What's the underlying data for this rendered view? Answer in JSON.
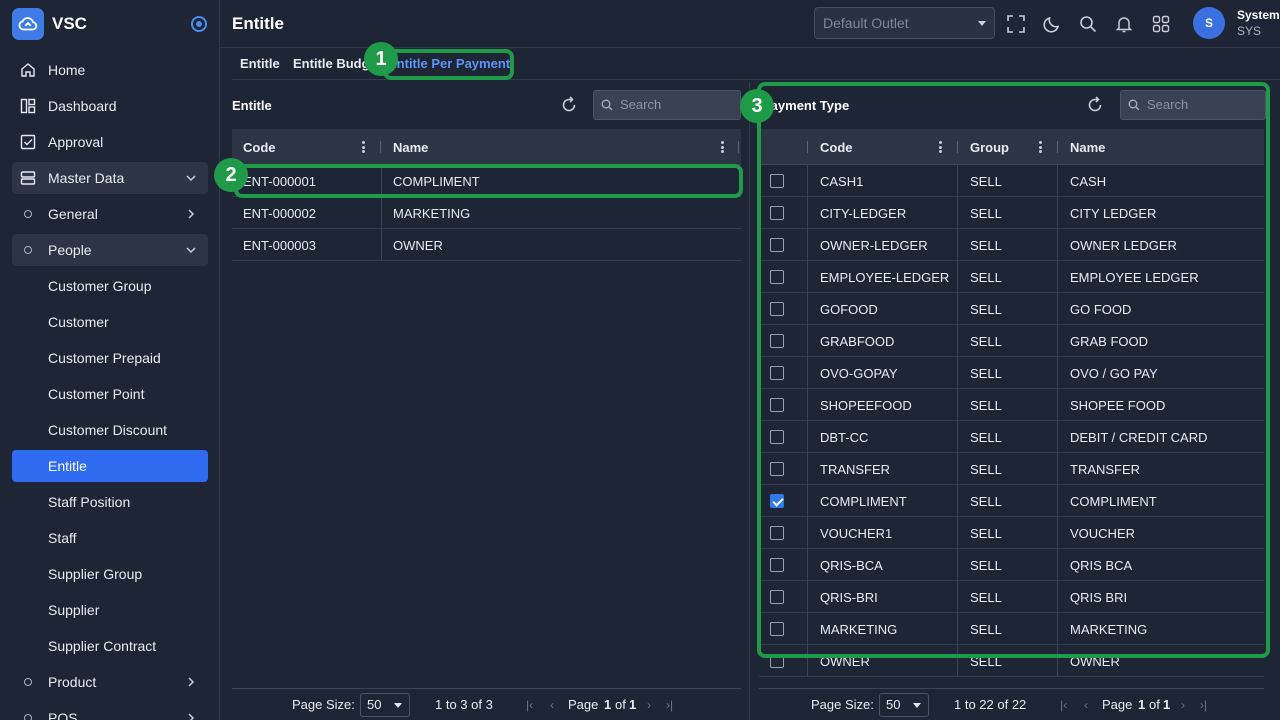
{
  "app": {
    "name": "VSC"
  },
  "topbar": {
    "title": "Entitle",
    "outlet_placeholder": "Default Outlet",
    "user": {
      "initial": "S",
      "name": "System",
      "code": "SYS"
    }
  },
  "sidebar": {
    "items": [
      {
        "label": "Home",
        "icon": "home-icon"
      },
      {
        "label": "Dashboard",
        "icon": "dashboard-icon"
      },
      {
        "label": "Approval",
        "icon": "approval-icon"
      },
      {
        "label": "Master Data",
        "icon": "database-icon"
      },
      {
        "label": "General"
      },
      {
        "label": "People"
      },
      {
        "label": "Customer Group"
      },
      {
        "label": "Customer"
      },
      {
        "label": "Customer Prepaid"
      },
      {
        "label": "Customer Point"
      },
      {
        "label": "Customer Discount"
      },
      {
        "label": "Entitle"
      },
      {
        "label": "Staff Position"
      },
      {
        "label": "Staff"
      },
      {
        "label": "Supplier Group"
      },
      {
        "label": "Supplier"
      },
      {
        "label": "Supplier Contract"
      },
      {
        "label": "Product"
      },
      {
        "label": "POS"
      }
    ]
  },
  "tabs": [
    "Entitle",
    "Entitle Budget",
    "Entitle Per Payment"
  ],
  "left_panel": {
    "title": "Entitle",
    "search_placeholder": "Search",
    "columns": [
      "Code",
      "Name"
    ],
    "rows": [
      {
        "code": "ENT-000001",
        "name": "COMPLIMENT"
      },
      {
        "code": "ENT-000002",
        "name": "MARKETING"
      },
      {
        "code": "ENT-000003",
        "name": "OWNER"
      }
    ],
    "pager": {
      "page_size_label": "Page Size:",
      "page_size": "50",
      "range": "1 to 3 of 3",
      "page_word": "Page",
      "page": "1",
      "of_word": "of",
      "total": "1"
    }
  },
  "right_panel": {
    "title": "Payment Type",
    "search_placeholder": "Search",
    "columns": [
      "Code",
      "Group",
      "Name"
    ],
    "rows": [
      {
        "code": "CASH1",
        "group": "SELL",
        "name": "CASH",
        "checked": false
      },
      {
        "code": "CITY-LEDGER",
        "group": "SELL",
        "name": "CITY LEDGER",
        "checked": false
      },
      {
        "code": "OWNER-LEDGER",
        "group": "SELL",
        "name": "OWNER LEDGER",
        "checked": false
      },
      {
        "code": "EMPLOYEE-LEDGER",
        "group": "SELL",
        "name": "EMPLOYEE LEDGER",
        "checked": false
      },
      {
        "code": "GOFOOD",
        "group": "SELL",
        "name": "GO FOOD",
        "checked": false
      },
      {
        "code": "GRABFOOD",
        "group": "SELL",
        "name": "GRAB FOOD",
        "checked": false
      },
      {
        "code": "OVO-GOPAY",
        "group": "SELL",
        "name": "OVO / GO PAY",
        "checked": false
      },
      {
        "code": "SHOPEEFOOD",
        "group": "SELL",
        "name": "SHOPEE FOOD",
        "checked": false
      },
      {
        "code": "DBT-CC",
        "group": "SELL",
        "name": "DEBIT / CREDIT CARD",
        "checked": false
      },
      {
        "code": "TRANSFER",
        "group": "SELL",
        "name": "TRANSFER",
        "checked": false
      },
      {
        "code": "COMPLIMENT",
        "group": "SELL",
        "name": "COMPLIMENT",
        "checked": true
      },
      {
        "code": "VOUCHER1",
        "group": "SELL",
        "name": "VOUCHER",
        "checked": false
      },
      {
        "code": "QRIS-BCA",
        "group": "SELL",
        "name": "QRIS BCA",
        "checked": false
      },
      {
        "code": "QRIS-BRI",
        "group": "SELL",
        "name": "QRIS BRI",
        "checked": false
      },
      {
        "code": "MARKETING",
        "group": "SELL",
        "name": "MARKETING",
        "checked": false
      },
      {
        "code": "OWNER",
        "group": "SELL",
        "name": "OWNER",
        "checked": false
      }
    ],
    "pager": {
      "page_size_label": "Page Size:",
      "page_size": "50",
      "range": "1 to 22 of 22",
      "page_word": "Page",
      "page": "1",
      "of_word": "of",
      "total": "1"
    }
  },
  "callouts": [
    "1",
    "2",
    "3"
  ],
  "colors": {
    "accent": "#2e6bf0",
    "callout": "#1f9a48",
    "background": "#1e2534"
  }
}
